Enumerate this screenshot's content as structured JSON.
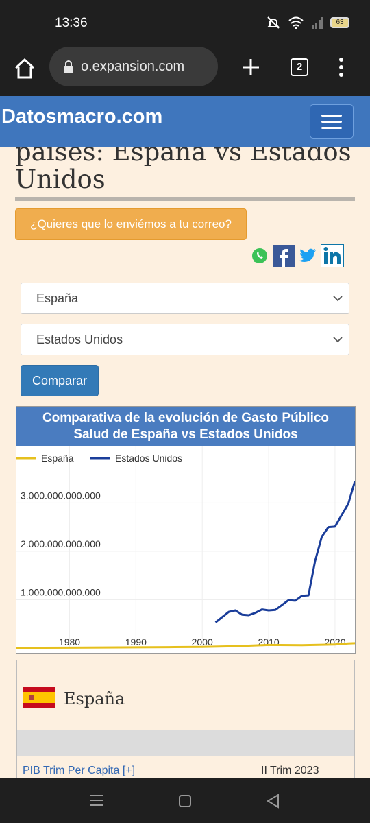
{
  "status": {
    "time": "13:36",
    "battery": "63"
  },
  "browser": {
    "url": "o.expansion.com",
    "tab_count": "2"
  },
  "site": {
    "brand": "Datosmacro.com"
  },
  "page": {
    "title_line1": "países: España vs Estados",
    "title_line2": "Unidos"
  },
  "actions": {
    "mail_button": "¿Quieres que lo enviémos a tu correo?",
    "compare_button": "Comparar"
  },
  "selects": {
    "country1": "España",
    "country2": "Estados Unidos"
  },
  "chart": {
    "title_line1": "Comparativa de la evolución de Gasto Público",
    "title_line2": "Salud de España vs Estados Unidos",
    "yticks": [
      "3.000.000.000.000",
      "2.000.000.000.000",
      "1.000.000.000.000"
    ],
    "xticks": [
      "1980",
      "1990",
      "2000",
      "2010",
      "2020"
    ]
  },
  "chart_data": {
    "type": "line",
    "title": "Comparativa de la evolución de Gasto Público Salud de España vs Estados Unidos",
    "xlim": [
      1972,
      2023
    ],
    "ylim": [
      0,
      3600000000000
    ],
    "legend": "top-left",
    "series": [
      {
        "name": "España",
        "color": "#e6c01e",
        "x": [
          1972,
          1980,
          1990,
          1995,
          2000,
          2005,
          2010,
          2015,
          2020,
          2022,
          2023
        ],
        "y": [
          5000000000,
          8000000000,
          15000000000,
          20000000000,
          25000000000,
          40000000000,
          65000000000,
          60000000000,
          75000000000,
          95000000000,
          100000000000
        ]
      },
      {
        "name": "Estados Unidos",
        "color": "#1a3d9a",
        "x": [
          2002,
          2003,
          2004,
          2005,
          2006,
          2007,
          2008,
          2009,
          2010,
          2011,
          2012,
          2013,
          2014,
          2015,
          2016,
          2017,
          2018,
          2019,
          2020,
          2021,
          2022,
          2023
        ],
        "y": [
          530000000000,
          640000000000,
          750000000000,
          780000000000,
          690000000000,
          680000000000,
          730000000000,
          800000000000,
          780000000000,
          790000000000,
          890000000000,
          990000000000,
          980000000000,
          1080000000000,
          1090000000000,
          1800000000000,
          2300000000000,
          2500000000000,
          2510000000000,
          2750000000000,
          2980000000000,
          3450000000000
        ]
      }
    ]
  },
  "panel": {
    "country": "España",
    "row_label": "PIB Trim Per Capita [+]",
    "row_value": "II Trim 2023"
  },
  "colors": {
    "brand_blue": "#3f76bd",
    "mail_orange": "#f0ad4e",
    "compare_blue": "#337ab7"
  }
}
